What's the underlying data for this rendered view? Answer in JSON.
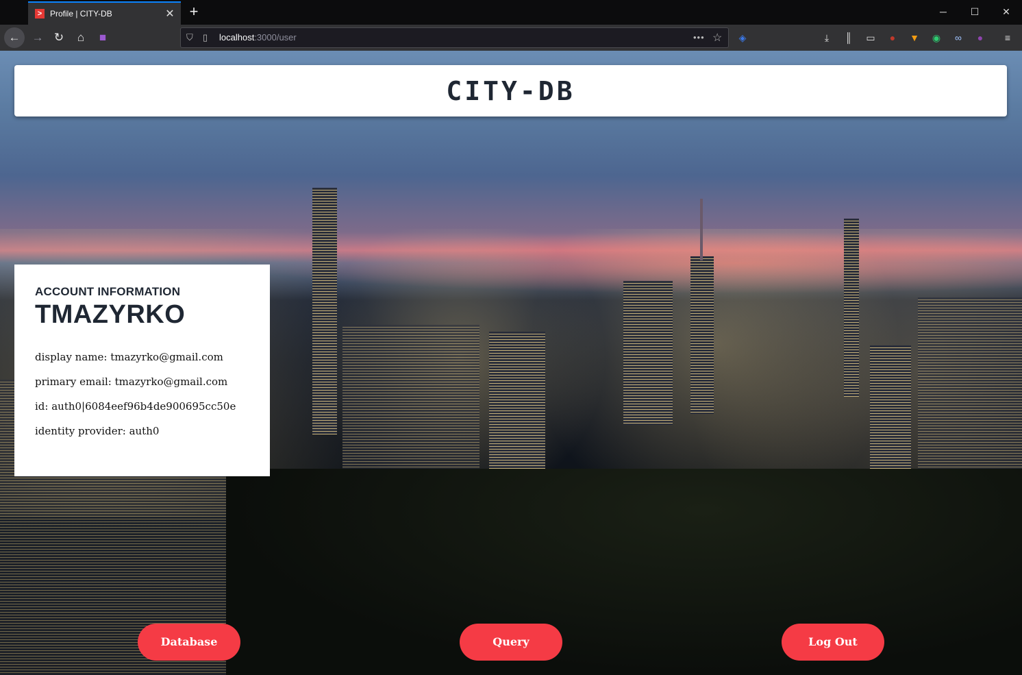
{
  "browser": {
    "tab_title": "Profile | CITY-DB",
    "tab_favicon": ">",
    "url_host": "localhost",
    "url_path": ":3000/user",
    "accent_color": "#0a84ff"
  },
  "page": {
    "site_title": "CITY-DB",
    "account": {
      "heading": "ACCOUNT INFORMATION",
      "username": "TMAZYRKO",
      "details": [
        "display name: tmazyrko@gmail.com",
        "primary email: tmazyrko@gmail.com",
        "id: auth0|6084eef96b4de900695cc50e",
        "identity provider: auth0"
      ]
    },
    "actions": {
      "database": "Database",
      "query": "Query",
      "logout": "Log Out"
    },
    "button_color": "#f53b45"
  }
}
